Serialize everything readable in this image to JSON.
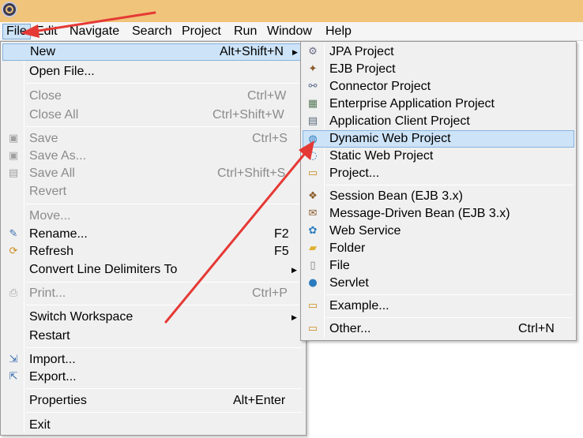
{
  "menubar": {
    "items": [
      "File",
      "Edit",
      "Navigate",
      "Search",
      "Project",
      "Run",
      "Window",
      "Help"
    ]
  },
  "file_menu": {
    "new": {
      "label": "New",
      "accel": "Alt+Shift+N"
    },
    "open_file": {
      "label": "Open File..."
    },
    "close": {
      "label": "Close",
      "accel": "Ctrl+W"
    },
    "close_all": {
      "label": "Close All",
      "accel": "Ctrl+Shift+W"
    },
    "save": {
      "label": "Save",
      "accel": "Ctrl+S"
    },
    "save_as": {
      "label": "Save As..."
    },
    "save_all": {
      "label": "Save All",
      "accel": "Ctrl+Shift+S"
    },
    "revert": {
      "label": "Revert"
    },
    "move": {
      "label": "Move..."
    },
    "rename": {
      "label": "Rename...",
      "accel": "F2"
    },
    "refresh": {
      "label": "Refresh",
      "accel": "F5"
    },
    "convert": {
      "label": "Convert Line Delimiters To"
    },
    "print": {
      "label": "Print...",
      "accel": "Ctrl+P"
    },
    "switch_workspace": {
      "label": "Switch Workspace"
    },
    "restart": {
      "label": "Restart"
    },
    "import": {
      "label": "Import..."
    },
    "export": {
      "label": "Export..."
    },
    "properties": {
      "label": "Properties",
      "accel": "Alt+Enter"
    },
    "exit": {
      "label": "Exit"
    }
  },
  "new_submenu": {
    "jpa": {
      "label": "JPA Project"
    },
    "ejb": {
      "label": "EJB Project"
    },
    "connector": {
      "label": "Connector Project"
    },
    "enterprise": {
      "label": "Enterprise Application Project"
    },
    "appclient": {
      "label": "Application Client Project"
    },
    "dynamic_web": {
      "label": "Dynamic Web Project"
    },
    "static_web": {
      "label": "Static Web Project"
    },
    "project": {
      "label": "Project..."
    },
    "session_bean": {
      "label": "Session Bean (EJB 3.x)"
    },
    "mdb": {
      "label": "Message-Driven Bean (EJB 3.x)"
    },
    "web_service": {
      "label": "Web Service"
    },
    "folder": {
      "label": "Folder"
    },
    "file": {
      "label": "File"
    },
    "servlet": {
      "label": "Servlet"
    },
    "example": {
      "label": "Example..."
    },
    "other": {
      "label": "Other...",
      "accel": "Ctrl+N"
    }
  },
  "colors": {
    "highlight": "#cde3f7",
    "annotation_arrow": "#e53935",
    "title_strip": "#f0c47a"
  }
}
